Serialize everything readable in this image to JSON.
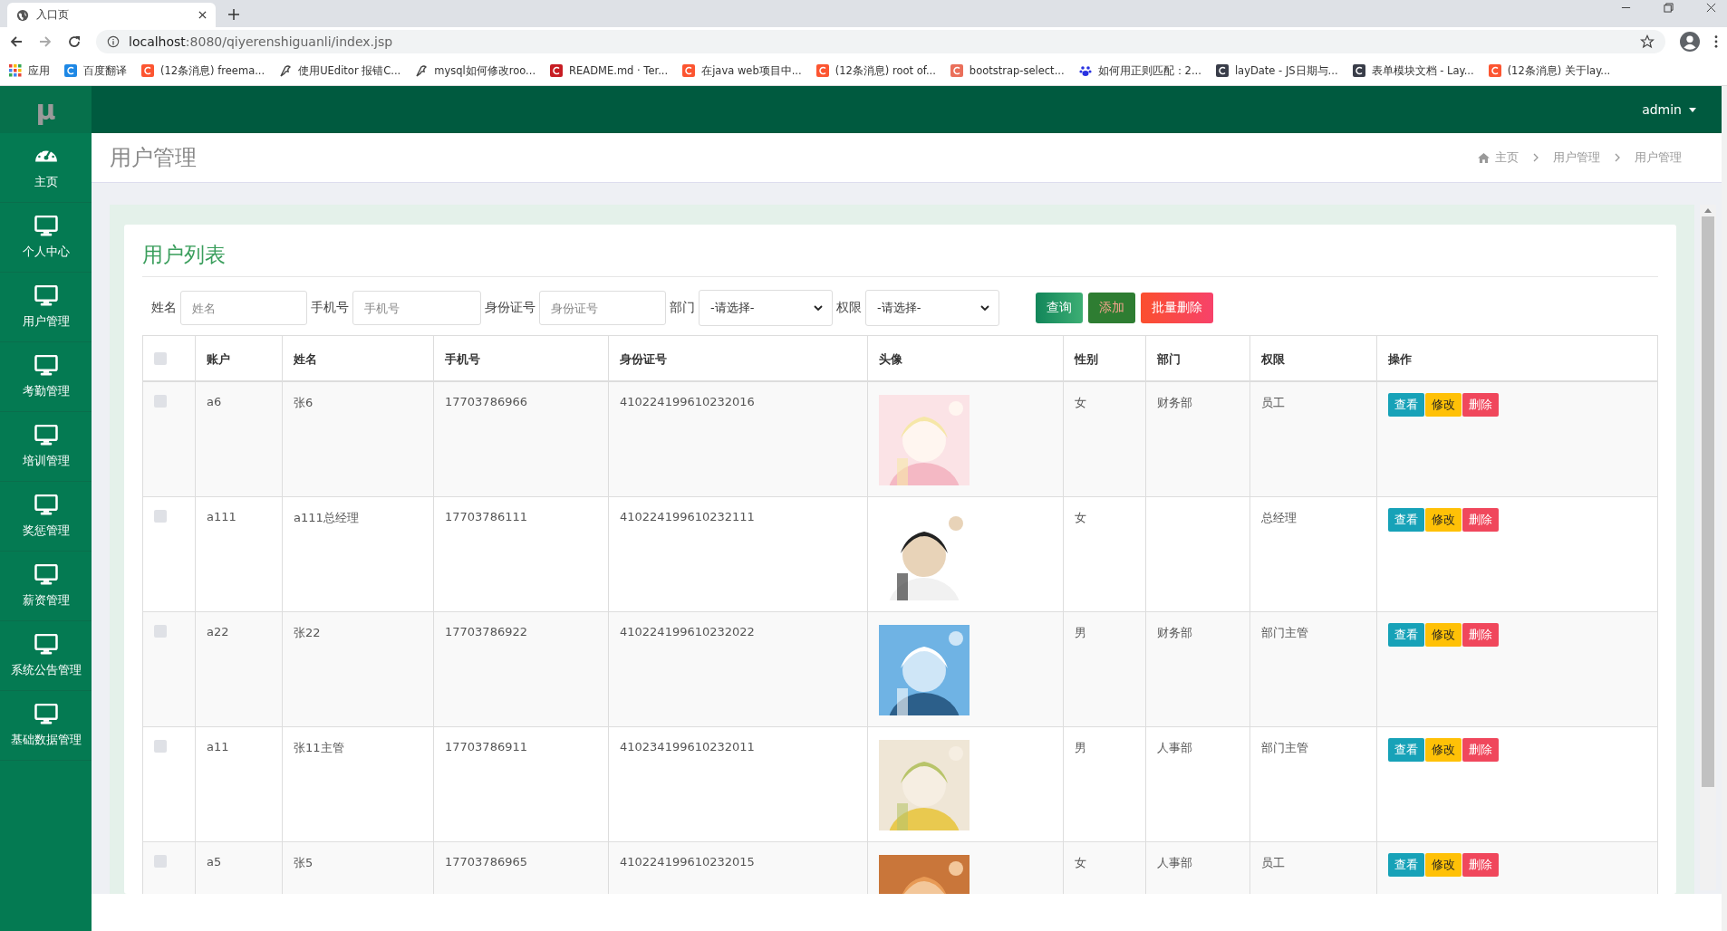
{
  "browser": {
    "tab_title": "入口页",
    "url_host": "localhost",
    "url_rest": ":8080/qiyerenshiguanli/index.jsp",
    "bookmarks": [
      {
        "label": "应用",
        "kind": "apps"
      },
      {
        "label": "百度翻译",
        "kind": "translate"
      },
      {
        "label": "(12条消息) freema...",
        "kind": "csdn"
      },
      {
        "label": "使用UEditor 报错C...",
        "kind": "feather"
      },
      {
        "label": "mysql如何修改roo...",
        "kind": "feather"
      },
      {
        "label": "README.md · Ter...",
        "kind": "gitee"
      },
      {
        "label": "在java web项目中...",
        "kind": "csdn"
      },
      {
        "label": "(12条消息) root of...",
        "kind": "csdn"
      },
      {
        "label": "bootstrap-select...",
        "kind": "jian"
      },
      {
        "label": "如何用正则匹配：2...",
        "kind": "baidu"
      },
      {
        "label": "layDate - JS日期与...",
        "kind": "layui"
      },
      {
        "label": "表单模块文档 - Lay...",
        "kind": "layui"
      },
      {
        "label": "(12条消息) 关于lay...",
        "kind": "csdn"
      }
    ]
  },
  "header": {
    "logo": "μ",
    "user": "admin"
  },
  "sidebar": {
    "items": [
      {
        "label": "主页"
      },
      {
        "label": "个人中心"
      },
      {
        "label": "用户管理"
      },
      {
        "label": "考勤管理"
      },
      {
        "label": "培训管理"
      },
      {
        "label": "奖惩管理"
      },
      {
        "label": "薪资管理"
      },
      {
        "label": "系统公告管理"
      },
      {
        "label": "基础数据管理"
      }
    ]
  },
  "page": {
    "title": "用户管理",
    "breadcrumb": [
      "主页",
      "用户管理",
      "用户管理"
    ]
  },
  "panel": {
    "title": "用户列表",
    "filters": [
      {
        "label": "姓名",
        "kind": "input",
        "placeholder": "姓名"
      },
      {
        "label": "手机号",
        "kind": "input",
        "placeholder": "手机号"
      },
      {
        "label": "身份证号",
        "kind": "input",
        "placeholder": "身份证号"
      },
      {
        "label": "部门",
        "kind": "select",
        "value": "-请选择-"
      },
      {
        "label": "权限",
        "kind": "select",
        "value": "-请选择-"
      }
    ],
    "buttons": [
      {
        "label": "查询",
        "kind": "search"
      },
      {
        "label": "添加",
        "kind": "add"
      },
      {
        "label": "批量删除",
        "kind": "delete"
      }
    ]
  },
  "table": {
    "header_checked": false,
    "columns": [
      "账户",
      "姓名",
      "手机号",
      "身份证号",
      "头像",
      "性别",
      "部门",
      "权限",
      "操作"
    ],
    "rows": [
      {
        "checked": false,
        "account": "a6",
        "name": "张6",
        "phone": "17703786966",
        "id_number": "410224199610232016",
        "gender": "女",
        "department": "财务部",
        "role": "员工",
        "actions": [
          {
            "label": "查看",
            "kind": "view"
          },
          {
            "label": "修改",
            "kind": "edit"
          },
          {
            "label": "删除",
            "kind": "delete"
          }
        ]
      },
      {
        "checked": false,
        "account": "a111",
        "name": "a111总经理",
        "phone": "17703786111",
        "id_number": "410224199610232111",
        "gender": "女",
        "role": "总经理",
        "actions": [
          {
            "label": "查看",
            "kind": "view"
          },
          {
            "label": "修改",
            "kind": "edit"
          },
          {
            "label": "删除",
            "kind": "delete"
          }
        ]
      },
      {
        "checked": false,
        "account": "a22",
        "name": "张22",
        "phone": "17703786922",
        "id_number": "410224199610232022",
        "gender": "男",
        "department": "财务部",
        "role": "部门主管",
        "actions": [
          {
            "label": "查看",
            "kind": "view"
          },
          {
            "label": "修改",
            "kind": "edit"
          },
          {
            "label": "删除",
            "kind": "delete"
          }
        ]
      },
      {
        "checked": false,
        "account": "a11",
        "name": "张11主管",
        "phone": "17703786911",
        "id_number": "410234199610232011",
        "gender": "男",
        "department": "人事部",
        "role": "部门主管",
        "actions": [
          {
            "label": "查看",
            "kind": "view"
          },
          {
            "label": "修改",
            "kind": "edit"
          },
          {
            "label": "删除",
            "kind": "delete"
          }
        ]
      },
      {
        "checked": false,
        "account": "a5",
        "name": "张5",
        "phone": "17703786965",
        "id_number": "410224199610232015",
        "gender": "女",
        "department": "人事部",
        "role": "员工",
        "actions": [
          {
            "label": "查看",
            "kind": "view"
          },
          {
            "label": "修改",
            "kind": "edit"
          },
          {
            "label": "删除",
            "kind": "delete"
          }
        ]
      }
    ]
  }
}
